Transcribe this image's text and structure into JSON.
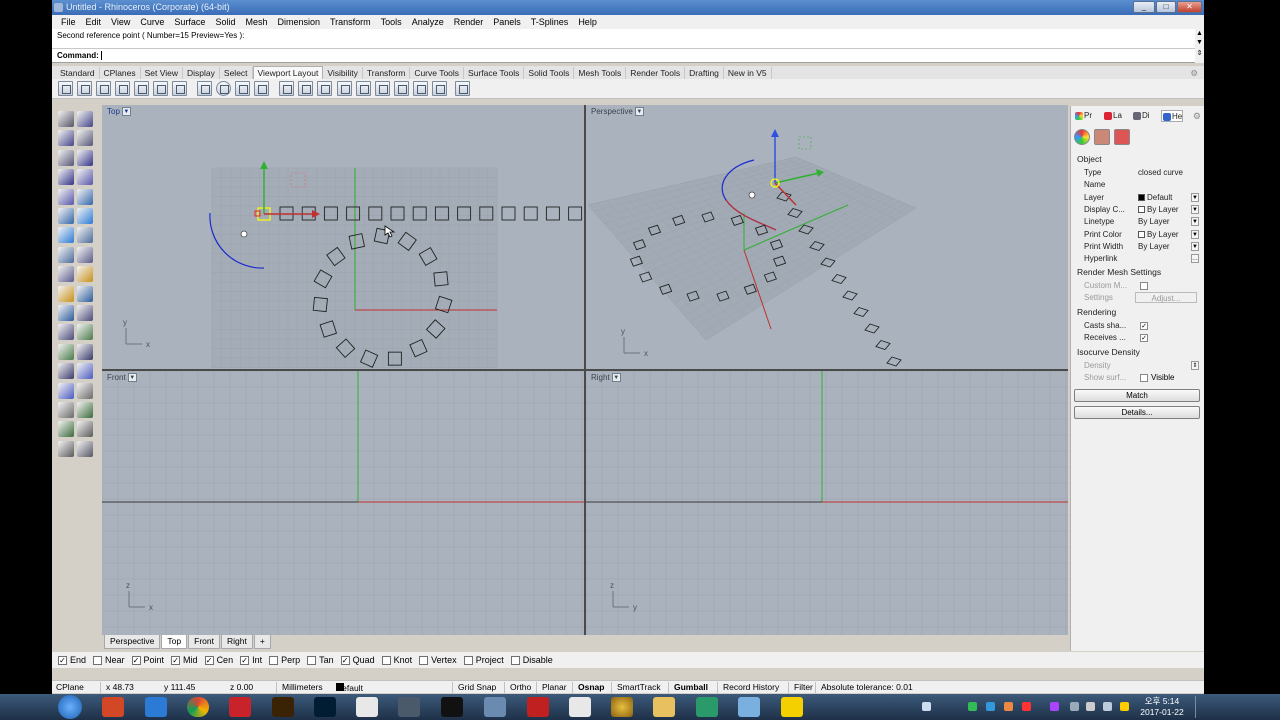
{
  "window": {
    "title": "Untitled - Rhinoceros (Corporate) (64-bit)"
  },
  "menu": [
    "File",
    "Edit",
    "View",
    "Curve",
    "Surface",
    "Solid",
    "Mesh",
    "Dimension",
    "Transform",
    "Tools",
    "Analyze",
    "Render",
    "Panels",
    "T-Splines",
    "Help"
  ],
  "command": {
    "history": "Second reference point ( Number=15  Preview=Yes ):",
    "prompt": "Command:"
  },
  "toolbar_tabs": [
    "Standard",
    "CPlanes",
    "Set View",
    "Display",
    "Select",
    "Viewport Layout",
    "Visibility",
    "Transform",
    "Curve Tools",
    "Surface Tools",
    "Solid Tools",
    "Mesh Tools",
    "Render Tools",
    "Drafting",
    "New in V5"
  ],
  "active_toolbar_tab": "Viewport Layout",
  "viewports": {
    "top": "Top",
    "perspective": "Perspective",
    "front": "Front",
    "right": "Right"
  },
  "viewport_tabs": [
    "Perspective",
    "Top",
    "Front",
    "Right"
  ],
  "active_viewport_tab": "Top",
  "axis": {
    "x": "x",
    "y": "y",
    "z": "z"
  },
  "osnaps": [
    {
      "label": "End",
      "checked": true
    },
    {
      "label": "Near",
      "checked": false
    },
    {
      "label": "Point",
      "checked": true
    },
    {
      "label": "Mid",
      "checked": true
    },
    {
      "label": "Cen",
      "checked": true
    },
    {
      "label": "Int",
      "checked": true
    },
    {
      "label": "Perp",
      "checked": false
    },
    {
      "label": "Tan",
      "checked": false
    },
    {
      "label": "Quad",
      "checked": true
    },
    {
      "label": "Knot",
      "checked": false
    },
    {
      "label": "Vertex",
      "checked": false
    },
    {
      "label": "Project",
      "checked": false
    },
    {
      "label": "Disable",
      "checked": false
    }
  ],
  "status": {
    "cplane": "CPlane",
    "x": "x 48.73",
    "y": "y 111.45",
    "z": "z 0.00",
    "units": "Millimeters",
    "layer": "Default",
    "grid_snap": "Grid Snap",
    "ortho": "Ortho",
    "planar": "Planar",
    "osnap": "Osnap",
    "smarttrack": "SmartTrack",
    "gumball": "Gumball",
    "record_history": "Record History",
    "filter": "Filter",
    "tolerance": "Absolute tolerance: 0.01"
  },
  "panel": {
    "tabs": [
      "Pr",
      "La",
      "Di",
      "He"
    ],
    "object_header": "Object",
    "props": [
      {
        "k": "Type",
        "v": "closed curve"
      },
      {
        "k": "Name",
        "v": ""
      },
      {
        "k": "Layer",
        "v": "Default"
      },
      {
        "k": "Display C...",
        "v": "By Layer"
      },
      {
        "k": "Linetype",
        "v": "By Layer"
      },
      {
        "k": "Print Color",
        "v": "By Layer"
      },
      {
        "k": "Print Width",
        "v": "By Layer"
      },
      {
        "k": "Hyperlink",
        "v": ""
      }
    ],
    "render_mesh_header": "Render Mesh Settings",
    "custom_mesh": "Custom M...",
    "settings": "Settings",
    "adjust": "Adjust...",
    "rendering_header": "Rendering",
    "casts_shadows": "Casts sha...",
    "receives_shadows": "Receives ...",
    "isocurve_header": "Isocurve Density",
    "density": "Density",
    "show_surface": "Show surf...",
    "visible": "Visible",
    "match_button": "Match",
    "details_button": "Details..."
  },
  "taskbar": {
    "time": "오후 5:14",
    "date": "2017-01-22"
  },
  "colors": {
    "x_axis": "#c03030",
    "y_axis": "#30b030",
    "z_axis": "#3050e0",
    "viewport_bg": "#aab3bd",
    "grid": "#9aa3ad",
    "selection": "#ffff00"
  }
}
